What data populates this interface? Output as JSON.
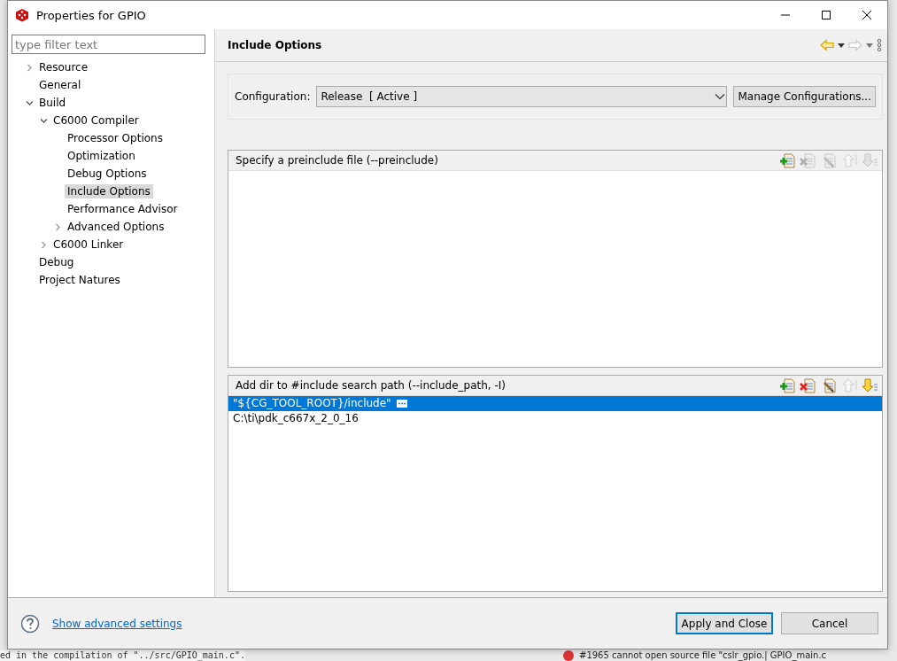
{
  "window": {
    "title": "Properties for GPIO"
  },
  "filter": {
    "placeholder": "type filter text"
  },
  "tree": [
    {
      "label": "Resource",
      "expanded": false,
      "selected": false
    },
    {
      "label": "General",
      "selected": false
    },
    {
      "label": "Build",
      "expanded": true,
      "selected": false,
      "children": [
        {
          "label": "C6000 Compiler",
          "expanded": true,
          "selected": false,
          "children": [
            {
              "label": "Processor Options",
              "selected": false
            },
            {
              "label": "Optimization",
              "selected": false
            },
            {
              "label": "Debug Options",
              "selected": false
            },
            {
              "label": "Include Options",
              "selected": true
            },
            {
              "label": "Performance Advisor",
              "selected": false
            },
            {
              "label": "Advanced Options",
              "expanded": false,
              "selected": false
            }
          ]
        },
        {
          "label": "C6000 Linker",
          "expanded": false,
          "selected": false
        }
      ]
    },
    {
      "label": "Debug",
      "selected": false
    },
    {
      "label": "Project Natures",
      "selected": false
    }
  ],
  "page": {
    "title": "Include Options"
  },
  "history": [
    {
      "kind": "back",
      "disabled": false
    },
    {
      "kind": "forward",
      "disabled": true
    }
  ],
  "configuration": {
    "label": "Configuration:",
    "value": "Release  [ Active ]",
    "button": "Manage Configurations..."
  },
  "lists": [
    {
      "title": "Specify a preinclude file (--preinclude)",
      "tools": [
        {
          "kind": "add",
          "disabled": false
        },
        {
          "kind": "delete",
          "disabled": true
        },
        {
          "kind": "edit",
          "disabled": true
        },
        {
          "kind": "up",
          "disabled": true
        },
        {
          "kind": "down",
          "disabled": true
        }
      ]
    },
    {
      "title": "Add dir to #include search path (--include_path, -I)",
      "tools": [
        {
          "kind": "add",
          "disabled": false
        },
        {
          "kind": "delete",
          "disabled": false
        },
        {
          "kind": "edit",
          "disabled": false
        },
        {
          "kind": "up",
          "disabled": true
        },
        {
          "kind": "down",
          "disabled": false
        }
      ],
      "items": [
        {
          "text": "\"${CG_TOOL_ROOT}/include\"",
          "selected": true
        },
        {
          "text": "C:\\ti\\pdk_c667x_2_0_16",
          "selected": false
        }
      ]
    }
  ],
  "footer": {
    "link": "Show advanced settings",
    "buttons": [
      {
        "label": "Apply and Close",
        "default": true
      },
      {
        "label": "Cancel",
        "default": false
      }
    ]
  },
  "background": {
    "left_line": "ed in the compilation of \"../src/GPIO_main.c\".",
    "problem": "#1965 cannot open source file \"cslr_gpio.| GPIO_main.c"
  }
}
